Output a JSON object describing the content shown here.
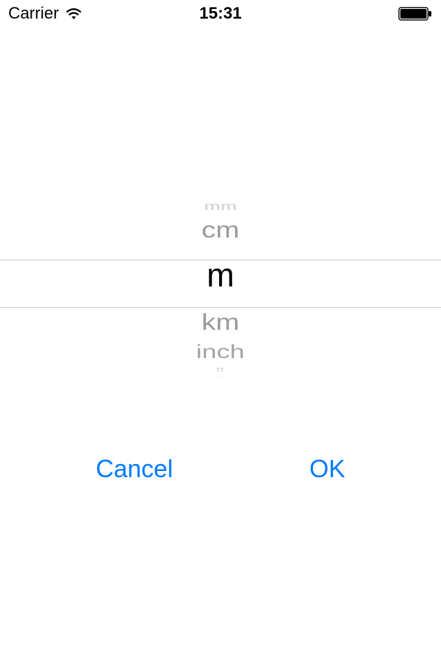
{
  "status_bar": {
    "carrier": "Carrier",
    "time": "15:31"
  },
  "picker": {
    "items": [
      "mm",
      "cm",
      "m",
      "km",
      "inch",
      "ft",
      "yd"
    ],
    "selected_index": 2
  },
  "buttons": {
    "cancel": "Cancel",
    "ok": "OK"
  },
  "colors": {
    "tint": "#007aff"
  }
}
